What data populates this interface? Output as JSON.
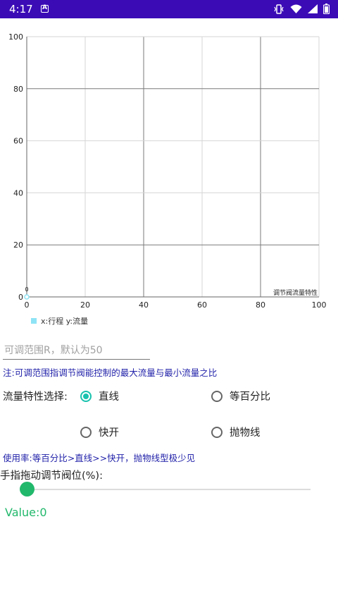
{
  "status_bar": {
    "time": "4:17",
    "notification_icon": "a-letter-icon",
    "icons": [
      "vibrate-icon",
      "wifi-icon",
      "signal-icon",
      "battery-icon"
    ],
    "bar_color": "#3b0bb6"
  },
  "chart_data": {
    "type": "line",
    "xlim": [
      0,
      100
    ],
    "ylim": [
      0,
      100
    ],
    "x_ticks": [
      "0",
      "20",
      "40",
      "60",
      "80",
      "100"
    ],
    "y_ticks": [
      "0",
      "20",
      "40",
      "60",
      "80",
      "100"
    ],
    "grid": true,
    "series": [
      {
        "name": "x:行程 y:流量",
        "color": "#8ee3f5",
        "points": [
          {
            "x": 0,
            "y": 0
          }
        ],
        "point_labels": [
          "0"
        ]
      }
    ],
    "description_text": "调节阀流量特性",
    "legend_position": "bottom-left"
  },
  "input": {
    "range_placeholder": "可调范围R，默认为50",
    "range_value": ""
  },
  "notes": {
    "range_note": "注:可调范围指调节阀能控制的最大流量与最小流量之比",
    "usage_note": "使用率:等百分比>直线>>快开，抛物线型极少见"
  },
  "selection": {
    "label": "流量特性选择:",
    "options": [
      {
        "label": "直线",
        "checked": true
      },
      {
        "label": "等百分比",
        "checked": false
      },
      {
        "label": "快开",
        "checked": false
      },
      {
        "label": "抛物线",
        "checked": false
      }
    ],
    "accent_color": "#19c2ae"
  },
  "slider": {
    "label": "手指拖动调节阀位(%):",
    "value": 0,
    "value_text": "Value:0",
    "accent_color": "#21b86b"
  }
}
